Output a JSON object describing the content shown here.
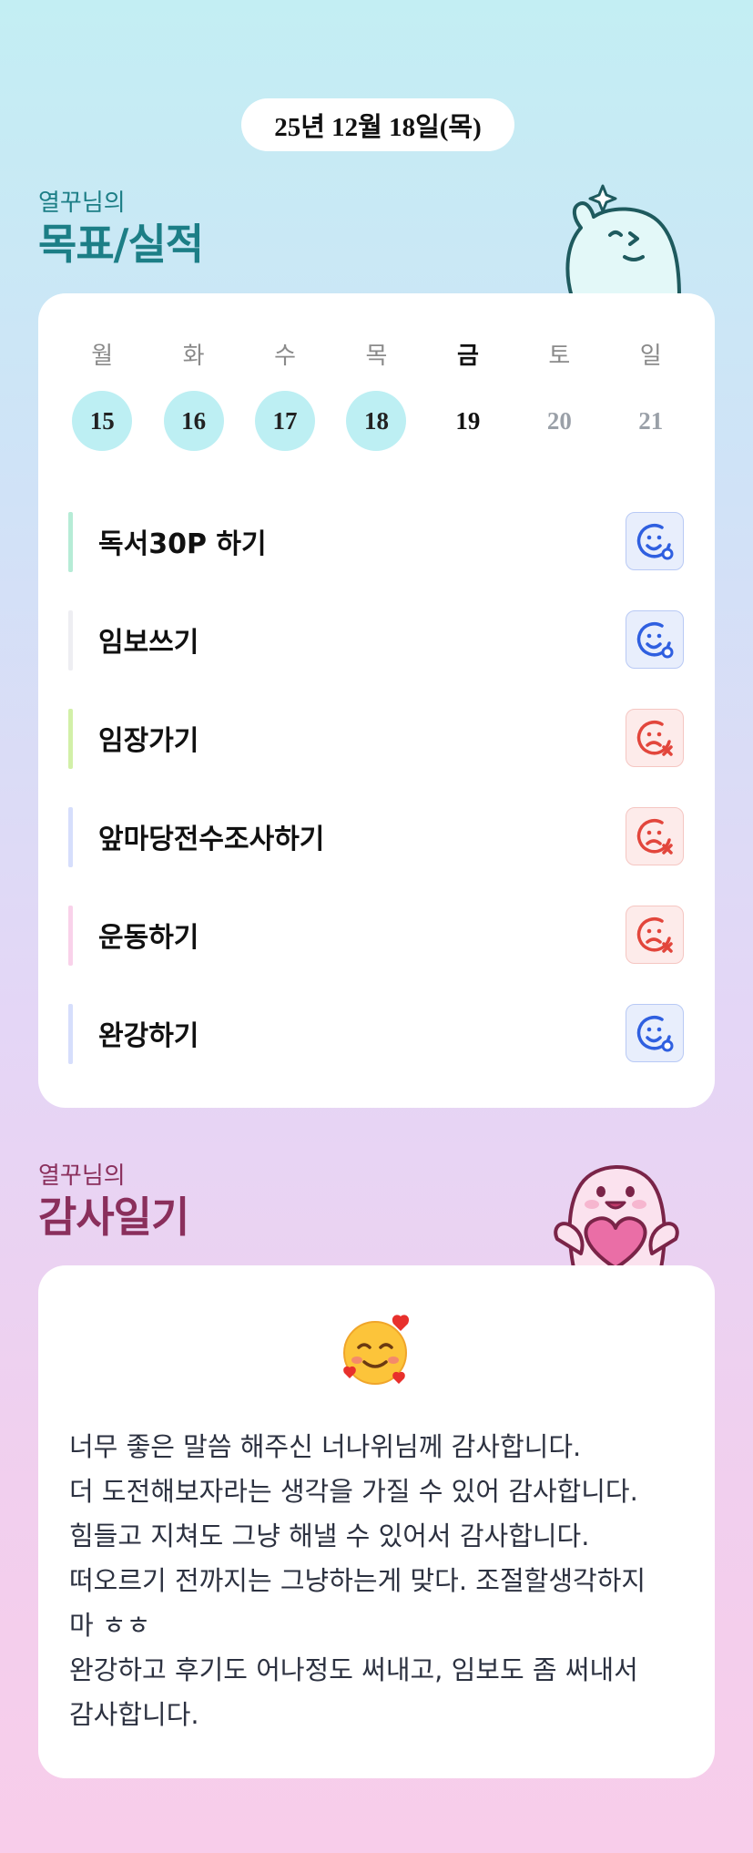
{
  "header": {
    "date": "25년 12월 18일(목)"
  },
  "goals_section": {
    "subtitle": "열꾸님의",
    "title": "목표/실적",
    "weekdays": [
      {
        "label": "월",
        "today": false
      },
      {
        "label": "화",
        "today": false
      },
      {
        "label": "수",
        "today": false
      },
      {
        "label": "목",
        "today": false
      },
      {
        "label": "금",
        "today": true
      },
      {
        "label": "토",
        "today": false
      },
      {
        "label": "일",
        "today": false
      }
    ],
    "days": [
      {
        "num": "15",
        "state": "done"
      },
      {
        "num": "16",
        "state": "done"
      },
      {
        "num": "17",
        "state": "done"
      },
      {
        "num": "18",
        "state": "done"
      },
      {
        "num": "19",
        "state": "today"
      },
      {
        "num": "20",
        "state": "future"
      },
      {
        "num": "21",
        "state": "future"
      }
    ],
    "items": [
      {
        "label": "독서30P 하기",
        "bar_color": "#b6ecd6",
        "status": "success",
        "icon": "smile-o-icon"
      },
      {
        "label": "임보쓰기",
        "bar_color": "#eeeef2",
        "status": "success",
        "icon": "smile-o-icon"
      },
      {
        "label": "임장가기",
        "bar_color": "#d2f0a8",
        "status": "fail",
        "icon": "sad-x-icon"
      },
      {
        "label": "앞마당전수조사하기",
        "bar_color": "#d6defc",
        "status": "fail",
        "icon": "sad-x-icon"
      },
      {
        "label": "운동하기",
        "bar_color": "#f9d2ea",
        "status": "fail",
        "icon": "sad-x-icon"
      },
      {
        "label": "완강하기",
        "bar_color": "#d6defc",
        "status": "success",
        "icon": "smile-o-icon"
      }
    ]
  },
  "gratitude_section": {
    "subtitle": "열꾸님의",
    "title": "감사일기",
    "emoji": "smiling-face-with-hearts-icon",
    "lines": [
      "너무 좋은 말씀 해주신 너나위님께 감사합니다.",
      "더 도전해보자라는 생각을 가질 수 있어 감사합니다.",
      "힘들고 지쳐도 그냥 해낼 수 있어서 감사합니다.",
      "떠오르기 전까지는 그냥하는게 맞다. 조절할생각하지",
      "마 ㅎㅎ",
      "완강하고 후기도 어나정도 써내고, 임보도 좀 써내서",
      "감사합니다."
    ]
  },
  "colors": {
    "success_icon": "#2f5fe0",
    "fail_icon": "#e2463c",
    "done_day_bg": "#bdeff3",
    "goals_title": "#1c7e86",
    "gratitude_title": "#8a2f5c"
  }
}
